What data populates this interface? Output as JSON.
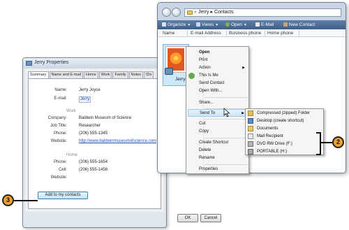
{
  "dialog": {
    "title": "Jerry Properties",
    "tabs": [
      "Summary",
      "Name and E-mail",
      "Home",
      "Work",
      "Family",
      "Notes",
      "IDs"
    ],
    "active_tab": "Summary",
    "summary": {
      "name_label": "Name:",
      "name": "Jerry Joyce",
      "email_label": "E-mail:",
      "email": "Jerry",
      "work_heading": "Work",
      "company_label": "Company:",
      "company": "Baldwin Museum of Science",
      "jobtitle_label": "Job Title:",
      "jobtitle": "Researcher",
      "work_phone_label": "Phone:",
      "work_phone": "(206) 555-1345",
      "work_website_label": "Website:",
      "work_website": "http://www.baldwinmuseumofscience.com",
      "home_heading": "Home",
      "home_phone_label": "Phone:",
      "home_phone": "(206) 555-1654",
      "cell_label": "Cell:",
      "cell": "(206) 555-1456",
      "home_website_label": "Website:",
      "home_website": ""
    },
    "add_button": "Add to my contacts",
    "ok": "OK",
    "cancel": "Cancel"
  },
  "explorer": {
    "address_sep": "»",
    "address": [
      "Jerry",
      "Contacts"
    ],
    "address_text": "Jerry ▸ Contacts",
    "toolbar": {
      "organize": "Organize",
      "views": "Views",
      "open": "Open",
      "email": "E-Mail",
      "new_contact": "New Contact"
    },
    "columns": [
      "Name",
      "E-mail Address",
      "Business phone",
      "Home phone"
    ],
    "file": {
      "name": "Jerry"
    }
  },
  "context_menu": {
    "items": [
      {
        "label": "Open",
        "bold": true
      },
      {
        "label": "Print"
      },
      {
        "label": "Action",
        "submenu": true
      },
      {
        "label": "This Is Me"
      },
      {
        "label": "Send Contact"
      },
      {
        "label": "Open With..."
      },
      {
        "label": "Share..."
      },
      {
        "label": "Send To",
        "submenu": true,
        "highlighted": true
      },
      {
        "label": "Cut"
      },
      {
        "label": "Copy"
      },
      {
        "label": "Create Shortcut"
      },
      {
        "label": "Delete"
      },
      {
        "label": "Rename"
      },
      {
        "label": "Properties"
      }
    ]
  },
  "send_to_menu": {
    "items": [
      "Compressed (zipped) Folder",
      "Desktop (create shortcut)",
      "Documents",
      "Mail Recipient",
      "DVD RW Drive (F:)",
      "PORTABLE (H:)"
    ]
  },
  "callouts": {
    "two": "2",
    "three": "3"
  },
  "colors": {
    "callout": "#f0a030",
    "toolbar": "#4f6f98",
    "highlight": "#cfe5f7",
    "link": "#1a52c5"
  }
}
